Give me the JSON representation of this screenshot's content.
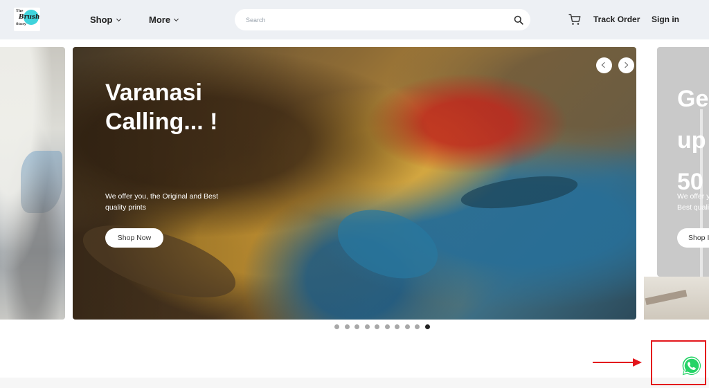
{
  "header": {
    "logo": {
      "line1": "The",
      "line2": "Brush",
      "line3": "Story"
    },
    "nav": [
      {
        "label": "Shop"
      },
      {
        "label": "More"
      }
    ],
    "search": {
      "placeholder": "Search",
      "value": ""
    },
    "links": {
      "track_order": "Track Order",
      "sign_in": "Sign in"
    }
  },
  "carousel": {
    "main_slide": {
      "title": "Varanasi Calling... !",
      "subtitle": "We offer you, the Original and Best quality prints",
      "button": "Shop Now"
    },
    "next_slide_partial": {
      "title_lines": [
        "Ge",
        "up",
        "50"
      ],
      "subtitle_lines": [
        "We offer y",
        "Best qualit"
      ],
      "button": "Shop I"
    },
    "dots_total": 10,
    "active_dot_index": 9
  },
  "whatsapp": {
    "icon": "whatsapp-icon",
    "highlight_color": "#e3161c"
  },
  "colors": {
    "header_bg": "#edf0f4",
    "annotation_red": "#e3161c",
    "whatsapp_green": "#25d366"
  }
}
